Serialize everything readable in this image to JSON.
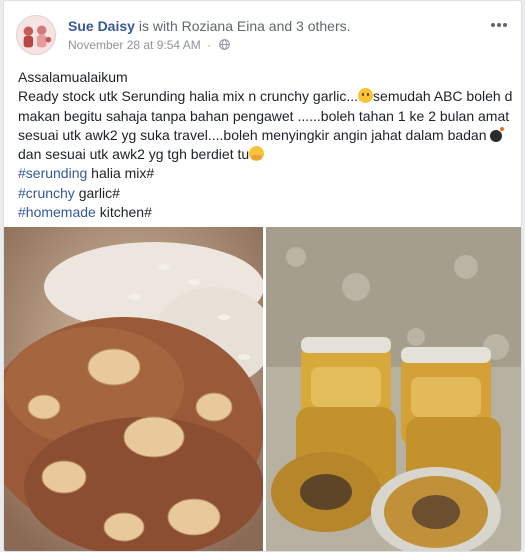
{
  "post": {
    "author": "Sue Daisy",
    "with_prefix": "is with",
    "tagged_first": "Roziana Eina",
    "and_word": "and",
    "tagged_others": "3 others.",
    "timestamp": "November 28 at 9:54 AM",
    "privacy_icon": "globe-icon",
    "more_icon": "more-options-icon",
    "text": {
      "greeting": "Assalamualaikum",
      "body_part1": "Ready stock utk Serunding halia mix n crunchy garlic...",
      "body_part2": "semudah ABC boleh d makan begitu sahaja tanpa bahan pengawet ......boleh tahan 1 ke 2 bulan amat sesuai utk awk2 yg suka travel....boleh menyingkir angin jahat dalam badan",
      "body_part3": " dan sesuai utk awk2 yg tgh berdiet tu"
    },
    "tags": [
      {
        "hashtag": "#serunding",
        "rest": " halia mix#"
      },
      {
        "hashtag": "#crunchy",
        "rest": " garlic#"
      },
      {
        "hashtag": "#homemade",
        "rest": " kitchen#"
      }
    ],
    "emojis": [
      "smiling-face-emoji",
      "bomb-emoji",
      "hugging-face-emoji"
    ],
    "photos": [
      "serunding-plate-photo",
      "jars-photo"
    ]
  },
  "colors": {
    "link": "#365899",
    "meta": "#90949c",
    "text": "#1d2129"
  }
}
